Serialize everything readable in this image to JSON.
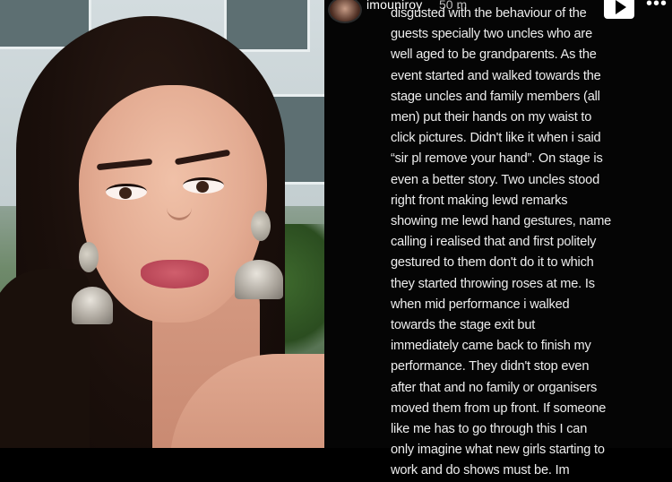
{
  "story": {
    "username": "imouniroy",
    "time": "50 m",
    "play_icon": "play-icon",
    "more_icon": "more-horizontal-icon",
    "more_label": "•••",
    "lines": [
      "disgusted with the behaviour of the",
      "guests specially two uncles who are",
      "well aged to be grandparents. As the",
      "event started and walked towards the",
      "stage uncles and family members (all",
      "men) put their hands on my waist to",
      "click pictures. Didn't like it when i said",
      "“sir pl remove your hand”. On stage is",
      "even a better story. Two uncles stood",
      "right front making lewd remarks",
      "showing me lewd hand gestures, name",
      "calling i realised that and first politely",
      "gestured to them don't do it to which",
      "they started throwing roses at me. Is",
      "when mid performance i walked",
      "towards the stage exit but",
      "immediately came back to finish my",
      "performance. They didn't stop even",
      "after that and no family or organisers",
      "moved them from up front. If someone",
      "like me has to go through this I can",
      "only imagine what new girls starting to",
      "work and do shows must be. Im"
    ]
  },
  "colors": {
    "story_background": "#050505",
    "story_text": "#ededed",
    "play_button": "#ffffff"
  }
}
